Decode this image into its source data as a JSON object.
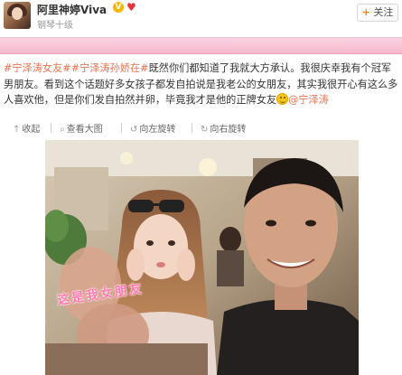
{
  "header": {
    "username": "阿里神婷Viva",
    "verified_badge": "V",
    "level": "钢琴十级",
    "follow_label": "关注"
  },
  "post": {
    "tag1": "#宁泽涛女友#",
    "tag2": "#宁泽涛孙娇在#",
    "text": "既然你们都知道了我就大方承认。我很庆幸我有个冠军男朋友。看到这个话题好多女孩子都发自拍说是我老公的女朋友，其实我很开心有这么多人喜欢他，但是你们发自拍然并卵，毕竟我才是他的正牌女友",
    "mention": "@宁泽涛"
  },
  "toolbar": {
    "collapse": "收起",
    "view_large": "查看大图",
    "rotate_left": "向左旋转",
    "rotate_right": "向右旋转"
  },
  "photo": {
    "caption": "这是我女朋友"
  },
  "colors": {
    "accent": "#eb7350",
    "banner": "#f6b8cc",
    "caption": "#ff7bb0"
  }
}
